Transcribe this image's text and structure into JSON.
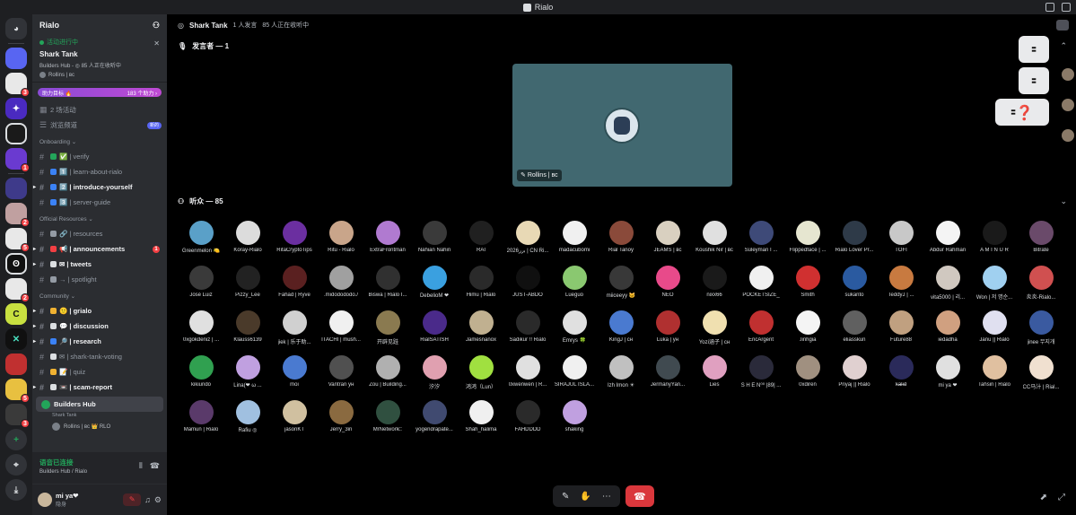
{
  "window": {
    "title": "Rialo"
  },
  "server": {
    "name": "Rialo",
    "event": {
      "status": "活动进行中",
      "title": "Shark Tank",
      "subtitle": "Builders Hub - ◎ 85 人正在收听中",
      "host": "Rollins | вс"
    },
    "boost": {
      "label": "助力目标 🔥",
      "count": "183 个助力 ›"
    }
  },
  "sidebar_top": [
    {
      "label": "2 场活动",
      "icon": "calendar-icon"
    },
    {
      "label": "浏览频道",
      "icon": "browse-icon",
      "pill": "新的"
    }
  ],
  "categories": [
    {
      "name": "Onboarding ⌄",
      "channels": [
        {
          "label": "✅ | verify",
          "bold": false,
          "color": "#23a55a"
        },
        {
          "label": "1️⃣ | learn-about-rialo",
          "bold": false,
          "color": "#3b82f6"
        },
        {
          "label": "2️⃣ | introduce-yourself",
          "bold": true,
          "color": "#3b82f6"
        },
        {
          "label": "3️⃣ | server-guide",
          "bold": false,
          "color": "#3b82f6"
        }
      ]
    },
    {
      "name": "Official Resources ⌄",
      "channels": [
        {
          "label": "🔗 | resources",
          "bold": false,
          "color": "#949ba4"
        },
        {
          "label": "📢 | announcements",
          "bold": true,
          "color": "#f23f43",
          "badge": "1"
        },
        {
          "label": "✉ | tweets",
          "bold": true,
          "color": "#dbdee1"
        },
        {
          "label": "→ | spotlight",
          "bold": false,
          "color": "#949ba4"
        }
      ]
    },
    {
      "name": "Community ⌄",
      "channels": [
        {
          "label": "🙂 | grialo",
          "bold": true,
          "color": "#f0b232"
        },
        {
          "label": "💬 | discussion",
          "bold": true,
          "color": "#dbdee1"
        },
        {
          "label": "🔎 | research",
          "bold": true,
          "color": "#3b82f6"
        },
        {
          "label": "✉ | shark-tank-voting",
          "bold": false,
          "color": "#dbdee1"
        },
        {
          "label": "📝 | quiz",
          "bold": false,
          "color": "#f0b232"
        },
        {
          "label": "📼 | scam-report",
          "bold": true,
          "color": "#dbdee1"
        }
      ]
    }
  ],
  "voice_channel": {
    "name": "Builders Hub",
    "sub": "Shark Tank",
    "member": "Rollins | вс 👑 RLO"
  },
  "voice_panel": {
    "status": "语音已连接",
    "location": "Builders Hub / Rialo"
  },
  "user": {
    "name": "mi ya❤",
    "status": "隐身"
  },
  "stage": {
    "title": "Shark Tank",
    "speaker_count": "1 人发言",
    "listener_count": "85 人正在收听中",
    "speakers_label": "发言者 — 1",
    "speaker_name": "Rollins | вс",
    "audience_label": "听众 — 85"
  },
  "audience": [
    {
      "name": "Greenmelon 🍋",
      "color": "#5aa0c8"
    },
    {
      "name": "Koray-Rialo",
      "color": "#dcdcdc"
    },
    {
      "name": "RitaCryptoTips",
      "color": "#6b2fa0"
    },
    {
      "name": "Ritu - Rialo",
      "color": "#c9a58a"
    },
    {
      "name": "ExtraFrontman",
      "color": "#b07ad0"
    },
    {
      "name": "Nahian Nahin",
      "color": "#3a3a3a"
    },
    {
      "name": "RAI",
      "color": "#202020"
    },
    {
      "name": "2026‏ﺑرر | CN Ri...",
      "color": "#e8d9b5"
    },
    {
      "name": "madacubomi",
      "color": "#f0f0f0"
    },
    {
      "name": "Rial Tanoy",
      "color": "#8a4a3a"
    },
    {
      "name": "JEAMS | вс",
      "color": "#d9d0c0"
    },
    {
      "name": "Koushik Nir | вс",
      "color": "#e0e0e0"
    },
    {
      "name": "Süleyman I ...",
      "color": "#3e4a78"
    },
    {
      "name": "Flippedface | ...",
      "color": "#e6e6d0"
    },
    {
      "name": "Rialo Lover Pr...",
      "color": "#2e3a48"
    },
    {
      "name": "TOFI",
      "color": "#c8c8c8"
    },
    {
      "name": "Abdur Rahman",
      "color": "#f4f4f4"
    },
    {
      "name": "A M I N U R",
      "color": "#1a1a1a"
    },
    {
      "name": "Bitrate",
      "color": "#6a4a6a"
    },
    {
      "name": "José Luiz",
      "color": "#3a3a3a"
    },
    {
      "name": "Pizzy_Lee",
      "color": "#222222"
    },
    {
      "name": "Fahad | Ryve",
      "color": "#5a2020"
    },
    {
      "name": ".midodododo./",
      "color": "#a0a0a0"
    },
    {
      "name": "Biswa | Rialo I...",
      "color": "#303030"
    },
    {
      "name": "DebelioM ❤",
      "color": "#3aa0e0"
    },
    {
      "name": "Himu | Rialo",
      "color": "#2a2a2a"
    },
    {
      "name": "JUST-ABDO",
      "color": "#101010"
    },
    {
      "name": "Lueguo",
      "color": "#8ac870"
    },
    {
      "name": "miiceeyy 🐱",
      "color": "#383838"
    },
    {
      "name": "NEO",
      "color": "#e84a8a"
    },
    {
      "name": "nixx66",
      "color": "#1a1a1a"
    },
    {
      "name": "POCKETSIZE_",
      "color": "#f0f0f0"
    },
    {
      "name": "Smith",
      "color": "#d03030"
    },
    {
      "name": "sukanto",
      "color": "#2a5aa0"
    },
    {
      "name": "TeddyJ | ...",
      "color": "#c87a40"
    },
    {
      "name": "vita5000 | 리...",
      "color": "#d0c8c0"
    },
    {
      "name": "Won | 저 명순...",
      "color": "#a0d0f0"
    },
    {
      "name": "炎炎-Rialo...",
      "color": "#d05050"
    },
    {
      "name": "0xgokdeniz | ...",
      "color": "#e0e0e0"
    },
    {
      "name": "Klauss6139",
      "color": "#4a3a2a"
    },
    {
      "name": "jiek | 乐于助...",
      "color": "#d0d0d0"
    },
    {
      "name": "ITACHI | mush...",
      "color": "#f0f0f0"
    },
    {
      "name": "开辟见跬",
      "color": "#8a7a50"
    },
    {
      "name": "RialSATISH",
      "color": "#4a2a8a"
    },
    {
      "name": "Jamesnanox",
      "color": "#c0b090"
    },
    {
      "name": "Sadikur !! Rialo",
      "color": "#2a2a2a"
    },
    {
      "name": "Emrys 🍀",
      "color": "#e0e0e0"
    },
    {
      "name": "KingJ | сн",
      "color": "#4a7ad0"
    },
    {
      "name": "Luka | ун",
      "color": "#b03030"
    },
    {
      "name": "Yozi涵子 | сн",
      "color": "#f0e0b0"
    },
    {
      "name": "EricArgent",
      "color": "#c03030"
    },
    {
      "name": ".linhgia",
      "color": "#f4f4f4"
    },
    {
      "name": "eliasskun",
      "color": "#606060"
    },
    {
      "name": "Future88",
      "color": "#c0a080"
    },
    {
      "name": "iedadha",
      "color": "#d0a080"
    },
    {
      "name": "Janu || Rialo",
      "color": "#e0e0f0"
    },
    {
      "name": "jinee 무지개",
      "color": "#3a5aa0"
    },
    {
      "name": "kikiundo",
      "color": "#30a050"
    },
    {
      "name": "Lina(❤ ω ...",
      "color": "#c0a0e0"
    },
    {
      "name": "moi",
      "color": "#4a7ad0"
    },
    {
      "name": "Vantran ун",
      "color": "#505050"
    },
    {
      "name": "Zou | Building...",
      "color": "#b0b0b0"
    },
    {
      "name": "汐汐",
      "color": "#e0a0b0"
    },
    {
      "name": "鸿鸿（Lun）",
      "color": "#a0e040"
    },
    {
      "name": "0xwenwen | R...",
      "color": "#e0e0e0"
    },
    {
      "name": "SIRAJUL ISLA...",
      "color": "#f0f0f0"
    },
    {
      "name": "Izh Imon ☀",
      "color": "#c0c0c0"
    },
    {
      "name": "JermanyYan...",
      "color": "#404a50"
    },
    {
      "name": "Lies",
      "color": "#e0a0c0"
    },
    {
      "name": "S H E N⁰⁰ |89| ...",
      "color": "#2a2a3a"
    },
    {
      "name": "0xdiren",
      "color": "#a09080"
    },
    {
      "name": "Priyaj || Rialo",
      "color": "#e0d0d0"
    },
    {
      "name": "k̶a̶l̶i̶d̶",
      "color": "#2a2a5a"
    },
    {
      "name": "mi ya ❤",
      "color": "#e0e0e0"
    },
    {
      "name": "Tahsin | Rialo",
      "color": "#e0c0a0"
    },
    {
      "name": "CC马汁 | Rial...",
      "color": "#f0e0d0"
    },
    {
      "name": "Mamun | Rialo",
      "color": "#5a3a6a"
    },
    {
      "name": "Rafiu ◎",
      "color": "#a0c0e0"
    },
    {
      "name": "jasonKT",
      "color": "#d0c0a0"
    },
    {
      "name": "Jerry_3in",
      "color": "#8a6a40"
    },
    {
      "name": "MrNetwork□",
      "color": "#305040"
    },
    {
      "name": "yogendrapate...",
      "color": "#404a70"
    },
    {
      "name": "Shah_halima",
      "color": "#f0f0f0"
    },
    {
      "name": "FAHDDDD",
      "color": "#2a2a2a"
    },
    {
      "name": "shaking",
      "color": "#c0a0e0"
    }
  ],
  "right_rail": [
    "⹀",
    "⹀",
    "⹀❓"
  ]
}
